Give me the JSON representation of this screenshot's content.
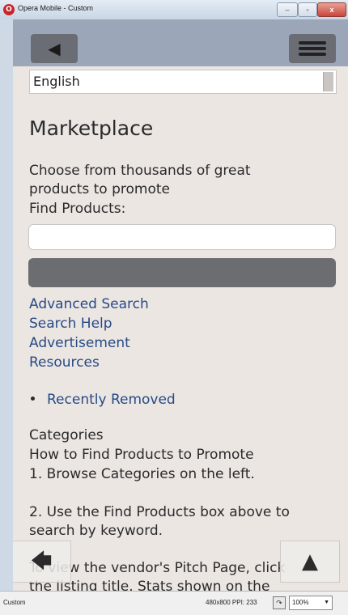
{
  "window": {
    "title": "Opera Mobile - Custom",
    "controls": {
      "minimize": "–",
      "maximize": "▫",
      "close": "x"
    }
  },
  "toolbar": {
    "back_icon": "chevron-left-icon",
    "menu_icon": "menu-icon"
  },
  "language_select": {
    "value": "English"
  },
  "page": {
    "title": "Marketplace",
    "intro_line1": "Choose from thousands of great",
    "intro_line2": "products to promote",
    "find_label": "Find Products:",
    "search_value": "",
    "search_button_label": "",
    "links": [
      "Advanced Search",
      "Search Help",
      "Advertisement",
      "Resources"
    ],
    "bullet_items": [
      "Recently Removed"
    ],
    "categories_heading": "Categories",
    "how_to_heading": "How to Find Products to Promote",
    "step1": "1. Browse Categories on the left.",
    "step2_line1": "2. Use the Find Products box above to",
    "step2_line2": "search by keyword.",
    "step3_partial": "To view the vendor's Pitch Page, click",
    "step3_cut": "the listing title. Stats shown on the"
  },
  "overlay": {
    "back_arrow": "🡄",
    "up_arrow": "▲"
  },
  "statusbar": {
    "profile": "Custom",
    "resolution": "480x800 PPI: 233",
    "rotate_icon": "rotate-icon",
    "zoom": "100%",
    "zoom_arrow": "▼"
  },
  "colors": {
    "frame_bg": "#ece6e3",
    "topbar": "#9ba7b9",
    "button_dark": "#6a6d73",
    "link": "#264a85"
  }
}
